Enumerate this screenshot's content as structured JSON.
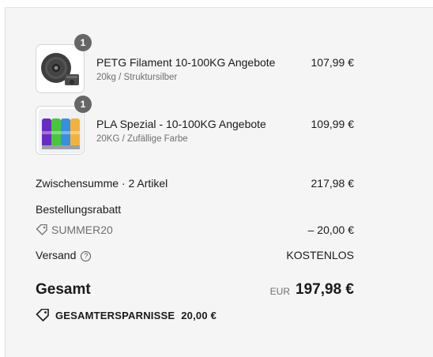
{
  "items": [
    {
      "name": "PETG Filament 10-100KG Angebote",
      "variant": "20kg / Struktursilber",
      "price": "107,99 €",
      "quantity": "1",
      "image_icon": "grey-filament-spools-icon"
    },
    {
      "name": "PLA Spezial - 10-100KG Angebote",
      "variant": "20KG / Zufällige Farbe",
      "price": "109,99 €",
      "quantity": "1",
      "image_icon": "colored-filament-spools-icon"
    }
  ],
  "summary": {
    "subtotal_label": "Zwischensumme · 2 Artikel",
    "subtotal_value": "217,98 €",
    "discount_label": "Bestellungsrabatt",
    "discount_code": "SUMMER20",
    "discount_value": "– 20,00 €",
    "shipping_label": "Versand",
    "shipping_help": "?",
    "shipping_value": "KOSTENLOS",
    "total_label": "Gesamt",
    "currency": "EUR",
    "total_value": "197,98 €",
    "savings_label": "GESAMTERSPARNISSE",
    "savings_value": "20,00 €"
  },
  "colors": {
    "panel": "#f5f5f5",
    "badge": "#666666",
    "muted": "#6f6f6f"
  }
}
